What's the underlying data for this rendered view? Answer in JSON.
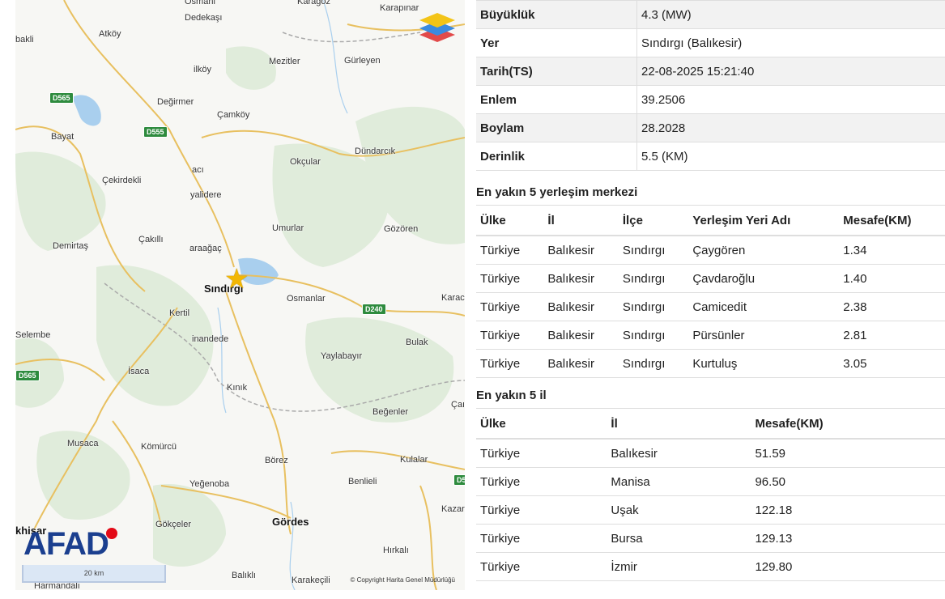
{
  "map": {
    "places": [
      {
        "name": "Osmanl",
        "cls": ""
      },
      {
        "name": "Dedekaşı",
        "cls": ""
      },
      {
        "name": "Karagöz",
        "cls": ""
      },
      {
        "name": "Karapınar",
        "cls": ""
      },
      {
        "name": "bakli",
        "cls": ""
      },
      {
        "name": "Atköy",
        "cls": ""
      },
      {
        "name": "Mezitler",
        "cls": ""
      },
      {
        "name": "Gürleyen",
        "cls": ""
      },
      {
        "name": "ilköy",
        "cls": ""
      },
      {
        "name": "Değirmer",
        "cls": ""
      },
      {
        "name": "Çamköy",
        "cls": ""
      },
      {
        "name": "Bayat",
        "cls": ""
      },
      {
        "name": "Dündarcık",
        "cls": ""
      },
      {
        "name": "Okçular",
        "cls": ""
      },
      {
        "name": "Çekirdekli",
        "cls": ""
      },
      {
        "name": "acı",
        "cls": ""
      },
      {
        "name": "yalidere",
        "cls": ""
      },
      {
        "name": "Umurlar",
        "cls": ""
      },
      {
        "name": "Gözören",
        "cls": ""
      },
      {
        "name": "Demirtaş",
        "cls": ""
      },
      {
        "name": "Çakıllı",
        "cls": ""
      },
      {
        "name": "araağaç",
        "cls": ""
      },
      {
        "name": "Sındırgı",
        "cls": "big"
      },
      {
        "name": "Osmanlar",
        "cls": ""
      },
      {
        "name": "Karac",
        "cls": ""
      },
      {
        "name": "Kertil",
        "cls": ""
      },
      {
        "name": "Selembe",
        "cls": ""
      },
      {
        "name": "inandede",
        "cls": ""
      },
      {
        "name": "Bulak",
        "cls": ""
      },
      {
        "name": "Yaylabayır",
        "cls": ""
      },
      {
        "name": "İsaca",
        "cls": ""
      },
      {
        "name": "Kınık",
        "cls": ""
      },
      {
        "name": "Çaı",
        "cls": ""
      },
      {
        "name": "Beğenler",
        "cls": ""
      },
      {
        "name": "Musaca",
        "cls": ""
      },
      {
        "name": "Kömürcü",
        "cls": ""
      },
      {
        "name": "Börez",
        "cls": ""
      },
      {
        "name": "Kulalar",
        "cls": ""
      },
      {
        "name": "Benlieli",
        "cls": ""
      },
      {
        "name": "Yeğenoba",
        "cls": ""
      },
      {
        "name": "Gökçeler",
        "cls": ""
      },
      {
        "name": "Kazar",
        "cls": ""
      },
      {
        "name": "Gördes",
        "cls": "big"
      },
      {
        "name": "khisar",
        "cls": "big"
      },
      {
        "name": "Hırkalı",
        "cls": ""
      },
      {
        "name": "Harmandalı",
        "cls": ""
      },
      {
        "name": "Balıklı",
        "cls": ""
      },
      {
        "name": "Karakeçili",
        "cls": ""
      }
    ],
    "shields": [
      "D565",
      "D555",
      "D240",
      "D565",
      "D5"
    ],
    "logo": "AFAD",
    "scale_label": "20 km",
    "copyright": "© Copyright Harita Genel Müdürlüğü",
    "layers_icon": "layers-icon",
    "epicenter_icon": "star-icon",
    "star_color": "#f2b705"
  },
  "details": {
    "rows": [
      {
        "label": "Büyüklük",
        "value": "4.3 (MW)"
      },
      {
        "label": "Yer",
        "value": "Sındırgı (Balıkesir)"
      },
      {
        "label": "Tarih(TS)",
        "value": "22-08-2025 15:21:40"
      },
      {
        "label": "Enlem",
        "value": "39.2506"
      },
      {
        "label": "Boylam",
        "value": "28.2028"
      },
      {
        "label": "Derinlik",
        "value": "5.5 (KM)"
      }
    ]
  },
  "nearest_settlements": {
    "title": "En yakın 5 yerleşim merkezi",
    "headers": [
      "Ülke",
      "İl",
      "İlçe",
      "Yerleşim Yeri Adı",
      "Mesafe(KM)"
    ],
    "rows": [
      [
        "Türkiye",
        "Balıkesir",
        "Sındırgı",
        "Çaygören",
        "1.34"
      ],
      [
        "Türkiye",
        "Balıkesir",
        "Sındırgı",
        "Çavdaroğlu",
        "1.40"
      ],
      [
        "Türkiye",
        "Balıkesir",
        "Sındırgı",
        "Camicedit",
        "2.38"
      ],
      [
        "Türkiye",
        "Balıkesir",
        "Sındırgı",
        "Pürsünler",
        "2.81"
      ],
      [
        "Türkiye",
        "Balıkesir",
        "Sındırgı",
        "Kurtuluş",
        "3.05"
      ]
    ]
  },
  "nearest_provinces": {
    "title": "En yakın 5 il",
    "headers": [
      "Ülke",
      "İl",
      "Mesafe(KM)"
    ],
    "rows": [
      [
        "Türkiye",
        "Balıkesir",
        "51.59"
      ],
      [
        "Türkiye",
        "Manisa",
        "96.50"
      ],
      [
        "Türkiye",
        "Uşak",
        "122.18"
      ],
      [
        "Türkiye",
        "Bursa",
        "129.13"
      ],
      [
        "Türkiye",
        "İzmir",
        "129.80"
      ]
    ]
  }
}
